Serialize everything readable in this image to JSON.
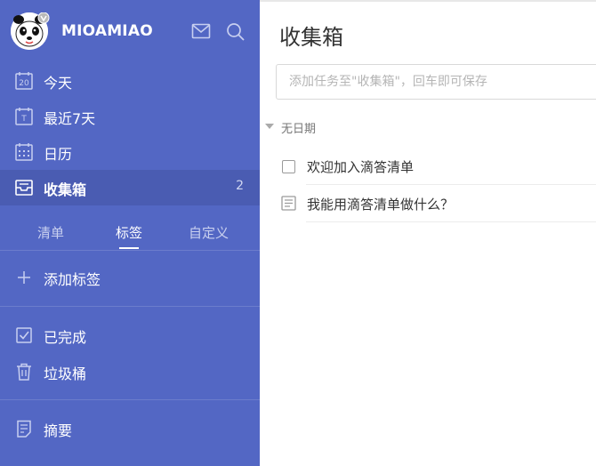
{
  "profile": {
    "username": "MIOAMIAO",
    "avatar_icon": "panda-avatar"
  },
  "sidebar": {
    "smart_lists": [
      {
        "label": "今天",
        "icon": "calendar-20-icon",
        "badge": "20"
      },
      {
        "label": "最近7天",
        "icon": "calendar-t-icon",
        "badge": "T"
      },
      {
        "label": "日历",
        "icon": "calendar-grid-icon"
      },
      {
        "label": "收集箱",
        "icon": "inbox-icon",
        "count": "2",
        "active": true
      }
    ],
    "tabs": [
      {
        "label": "清单",
        "active": false
      },
      {
        "label": "标签",
        "active": true
      },
      {
        "label": "自定义",
        "active": false
      }
    ],
    "add_tag": {
      "label": "添加标签",
      "icon": "plus-icon"
    },
    "bottom_items": [
      {
        "label": "已完成",
        "icon": "check-box-icon"
      },
      {
        "label": "垃圾桶",
        "icon": "trash-icon"
      }
    ],
    "summary": {
      "label": "摘要",
      "icon": "summary-icon"
    }
  },
  "main": {
    "title": "收集箱",
    "add_task_placeholder": "添加任务至\"收集箱\"，回车即可保存",
    "section_label": "无日期",
    "tasks": [
      {
        "text": "欢迎加入滴答清单",
        "type": "checkbox"
      },
      {
        "text": "我能用滴答清单做什么？",
        "type": "note"
      }
    ]
  },
  "colors": {
    "sidebar_bg": "#5367c4",
    "sidebar_active": "#4a5cb2",
    "main_bg": "#ffffff"
  }
}
